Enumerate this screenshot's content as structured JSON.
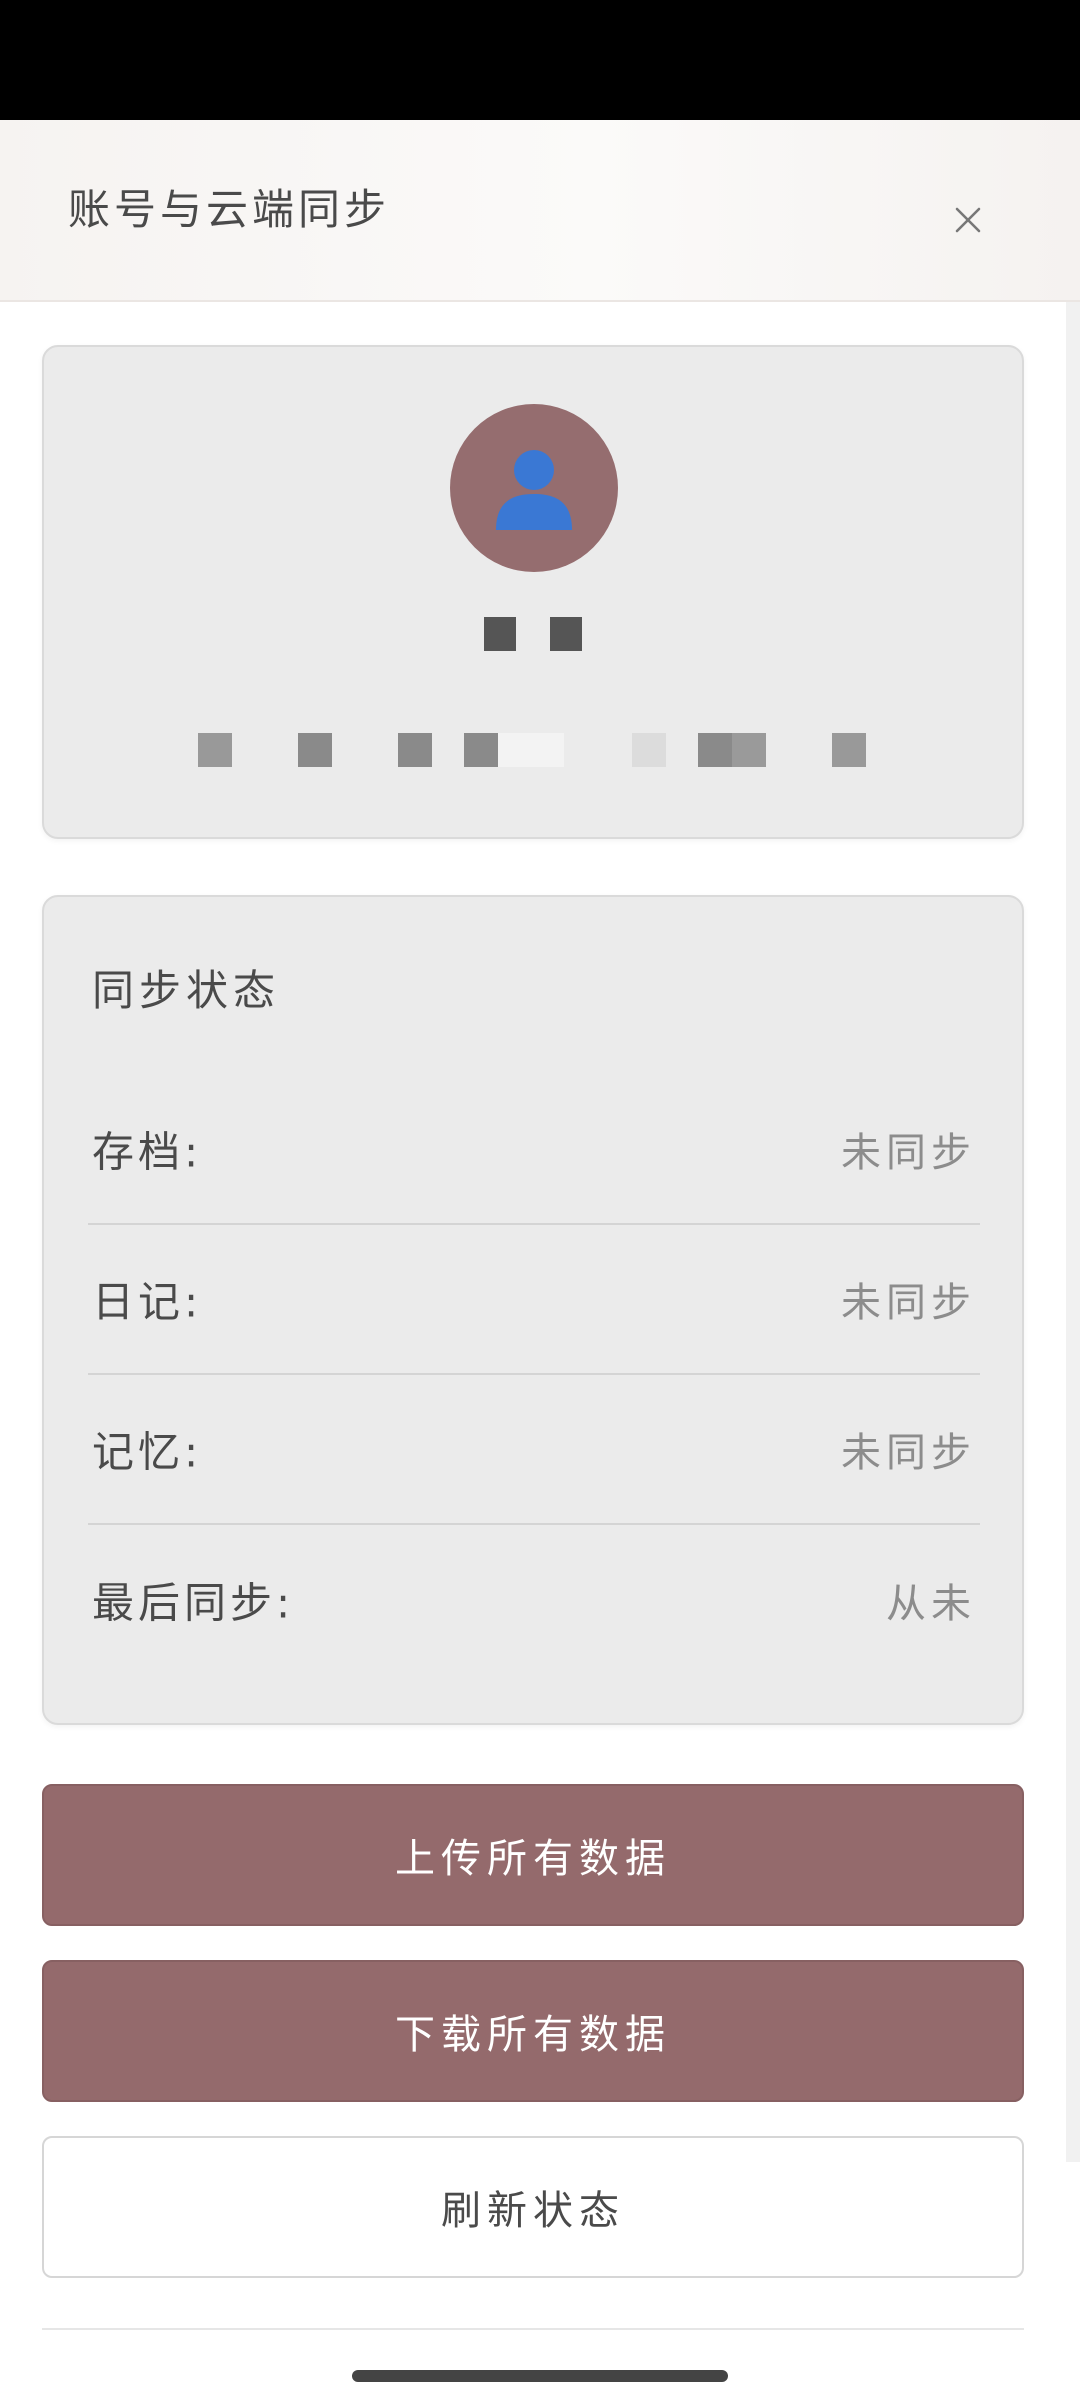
{
  "header": {
    "title": "账号与云端同步"
  },
  "profile": {
    "avatar_icon": "user-silhouette-icon",
    "avatar_bg": "#956d6f",
    "avatar_fg": "#3a78d4",
    "username": "██",
    "email": "████████"
  },
  "sync_status": {
    "title": "同步状态",
    "rows": [
      {
        "label": "存档:",
        "value": "未同步"
      },
      {
        "label": "日记:",
        "value": "未同步"
      },
      {
        "label": "记忆:",
        "value": "未同步"
      },
      {
        "label": "最后同步:",
        "value": "从未"
      }
    ]
  },
  "actions": {
    "upload_label": "上传所有数据",
    "download_label": "下载所有数据",
    "refresh_label": "刷新状态"
  },
  "colors": {
    "primary": "#946a6c",
    "card_bg": "#ebebeb"
  }
}
